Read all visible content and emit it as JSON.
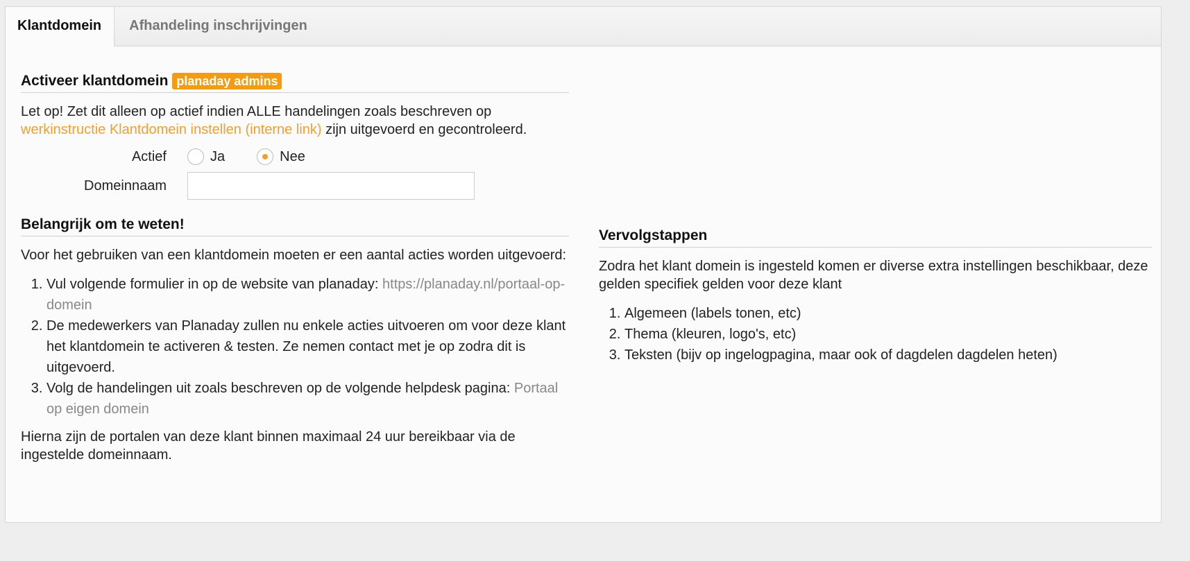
{
  "tabs": [
    {
      "label": "Klantdomein"
    },
    {
      "label": "Afhandeling inschrijvingen"
    }
  ],
  "activate": {
    "title": "Activeer klantdomein",
    "badge": "planaday admins",
    "warning_text": "Let op! Zet dit alleen op actief indien ALLE handelingen zoals beschreven op",
    "warning_link": "werkinstructie Klantdomein instellen (interne link)",
    "warning_suffix": " zijn uitgevoerd en gecontroleerd.",
    "actief_label": "Actief",
    "option_yes": "Ja",
    "option_no": "Nee",
    "selected": "Nee",
    "domain_label": "Domeinnaam",
    "domain_value": ""
  },
  "important": {
    "title": "Belangrijk om te weten!",
    "intro": "Voor het gebruiken van een klantdomein moeten er een aantal acties worden uitgevoerd:",
    "steps": [
      {
        "text": "Vul volgende formulier in op de website van planaday: ",
        "link": "https://planaday.nl/portaal-op-domein"
      },
      {
        "text": "De medewerkers van Planaday zullen nu enkele acties uitvoeren om voor deze klant het klantdomein te activeren & testen. Ze nemen contact met je op zodra dit is uitgevoerd.",
        "link": ""
      },
      {
        "text": "Volg de handelingen uit zoals beschreven op de volgende helpdesk pagina: ",
        "link": "Portaal op eigen domein"
      }
    ],
    "outro": "Hierna zijn de portalen van deze klant binnen maximaal 24 uur bereikbaar via de ingestelde domeinnaam."
  },
  "next": {
    "title": "Vervolgstappen",
    "intro": "Zodra het klant domein is ingesteld komen er diverse extra instellingen beschikbaar, deze gelden specifiek gelden voor deze klant",
    "steps": [
      "Algemeen (labels tonen, etc)",
      "Thema (kleuren, logo's, etc)",
      "Teksten (bijv op ingelogpagina, maar ook of dagdelen dagdelen heten)"
    ]
  },
  "colors": {
    "accent": "#f39c12",
    "link_orange": "#f0a030",
    "link_grey": "#888888"
  }
}
